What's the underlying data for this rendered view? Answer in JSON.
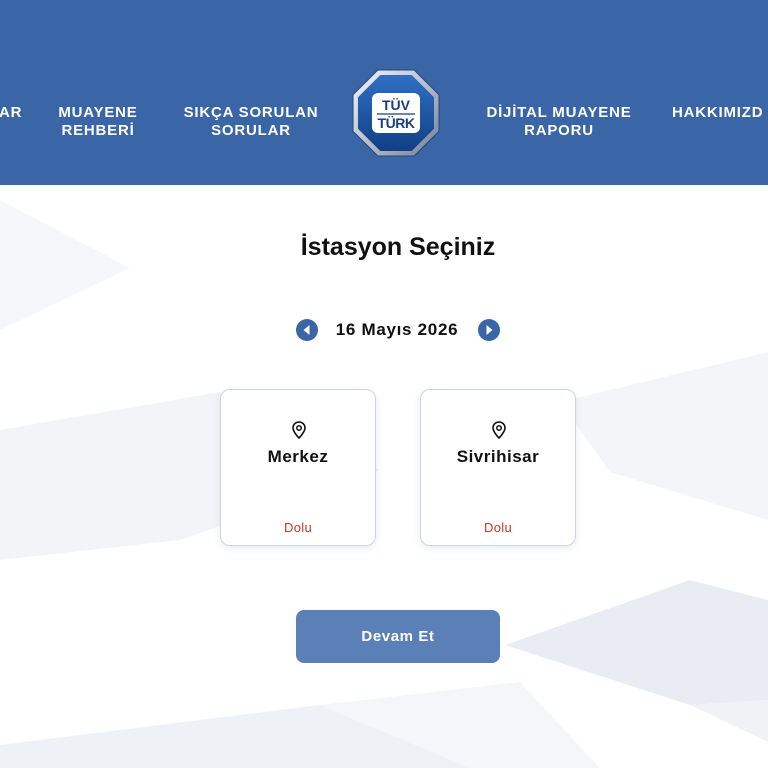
{
  "header": {
    "background_color": "#3a65a7",
    "nav_left": [
      {
        "lines": [
          "AR"
        ]
      },
      {
        "lines": [
          "MUAYENE",
          "REHBERİ"
        ]
      },
      {
        "lines": [
          "SIKÇA SORULAN",
          "SORULAR"
        ]
      }
    ],
    "logo": {
      "icon": "tuv-turk-logo",
      "line1": "TÜV",
      "line2": "TÜRK"
    },
    "nav_right": [
      {
        "lines": [
          "DİJİTAL MUAYENE",
          "RAPORU"
        ]
      },
      {
        "lines": [
          "HAKKIMIZD"
        ]
      }
    ]
  },
  "page_title": "İstasyon Seçiniz",
  "date_picker": {
    "prev_icon": "caret-left-icon",
    "date": "16 Mayıs 2026",
    "next_icon": "caret-right-icon",
    "accent_color": "#3a65a7"
  },
  "stations": [
    {
      "icon": "map-pin-icon",
      "name": "Merkez",
      "status": "Dolu"
    },
    {
      "icon": "map-pin-icon",
      "name": "Sivrihisar",
      "status": "Dolu"
    }
  ],
  "status_color": "#c0392b",
  "continue_button": {
    "label": "Devam Et",
    "color": "#5b80b7"
  }
}
